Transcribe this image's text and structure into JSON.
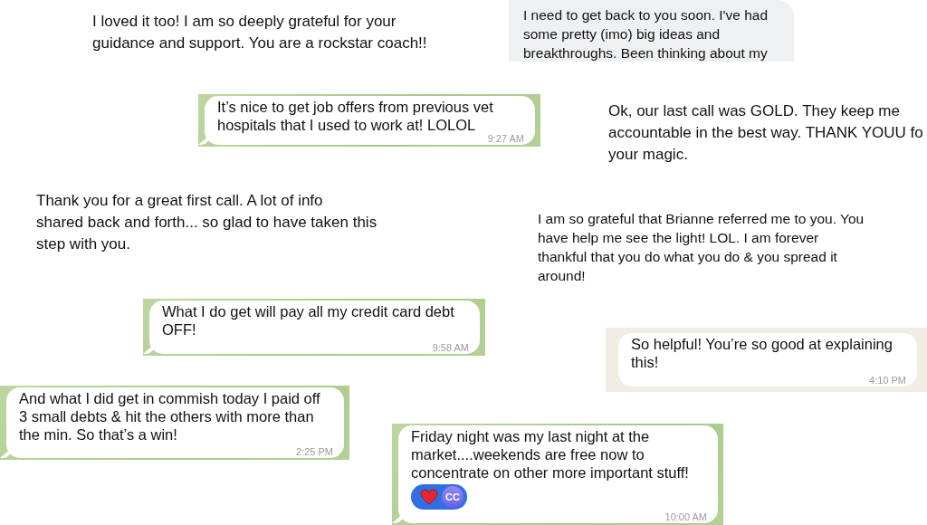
{
  "messages": [
    {
      "kind": "plain",
      "lines": [
        "I loved it too! I am so deeply grateful for your",
        "guidance and support. You are a rockstar coach!!"
      ]
    },
    {
      "kind": "gray_bubble",
      "lines": [
        "I need to get back to you soon. I've had",
        "some pretty (imo) big ideas and",
        "breakthroughs. Been thinking about my"
      ]
    },
    {
      "kind": "green_bubble",
      "lines": [
        "It’s nice to get job offers from previous vet",
        "hospitals that I used to work at! LOLOL"
      ],
      "time": "9:27 AM"
    },
    {
      "kind": "plain",
      "lines": [
        "Ok, our last call was GOLD. They keep me",
        "accountable in the best way. THANK YOUU fo",
        "your magic."
      ]
    },
    {
      "kind": "plain",
      "lines": [
        "Thank you for a great first call.  A lot of info",
        "shared back and forth... so glad to have taken this",
        "step with you."
      ]
    },
    {
      "kind": "plain_small",
      "lines": [
        "I am so grateful that Brianne referred me to you. You",
        "have help me see the light! LOL.  I am forever",
        "thankful that you do what you do & you spread it",
        "around!"
      ]
    },
    {
      "kind": "green_bubble",
      "lines": [
        "What I do get will pay all my credit card debt",
        "OFF!"
      ],
      "time": "9:58 AM"
    },
    {
      "kind": "beige_bubble",
      "lines": [
        "So helpful! You’re so good at explaining",
        "this!"
      ],
      "time": "4:10 PM"
    },
    {
      "kind": "green_bubble",
      "lines": [
        "And what I did get in commish today I paid off",
        "3 small debts & hit the others with more than",
        "the min. So that’s a win!"
      ],
      "time": "2:25 PM"
    },
    {
      "kind": "green_bubble",
      "lines": [
        "Friday night was my last night at the",
        "market....weekends are free now to",
        "concentrate on other more important stuff!"
      ],
      "reaction": {
        "avatar": "CC"
      },
      "time": "10:00 AM"
    }
  ]
}
